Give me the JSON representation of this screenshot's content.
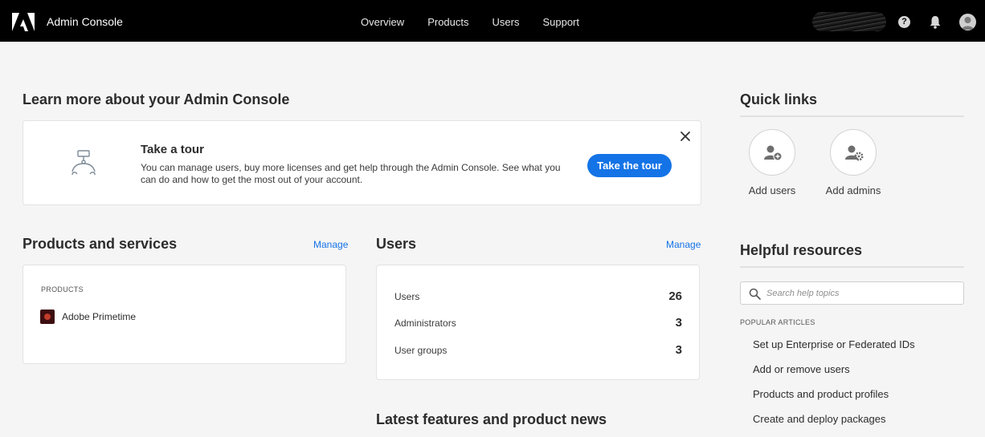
{
  "header": {
    "app_title": "Admin Console",
    "nav": [
      "Overview",
      "Products",
      "Users",
      "Support"
    ],
    "icons": [
      "adobe-logo-icon",
      "help-icon",
      "bell-icon",
      "avatar"
    ]
  },
  "learn": {
    "heading": "Learn more about your Admin Console",
    "tour_title": "Take a tour",
    "tour_text": "You can manage users, buy more licenses and get help through the Admin Console. See what you can do and how to get the most out of your account.",
    "tour_button": "Take the tour"
  },
  "products": {
    "heading": "Products and services",
    "manage": "Manage",
    "section_label": "PRODUCTS",
    "items": [
      {
        "name": "Adobe Primetime"
      }
    ]
  },
  "users": {
    "heading": "Users",
    "manage": "Manage",
    "stats": [
      {
        "label": "Users",
        "value": "26"
      },
      {
        "label": "Administrators",
        "value": "3"
      },
      {
        "label": "User groups",
        "value": "3"
      }
    ]
  },
  "news": {
    "heading": "Latest features and product news"
  },
  "quick_links": {
    "heading": "Quick links",
    "items": [
      {
        "label": "Add users",
        "icon": "add-user-icon"
      },
      {
        "label": "Add admins",
        "icon": "add-admin-icon"
      }
    ]
  },
  "resources": {
    "heading": "Helpful resources",
    "search_placeholder": "Search help topics",
    "popular_label": "POPULAR ARTICLES",
    "articles": [
      "Set up Enterprise or Federated IDs",
      "Add or remove users",
      "Products and product profiles",
      "Create and deploy packages"
    ]
  },
  "colors": {
    "accent": "#1473e6",
    "topbar": "#000000",
    "background": "#f5f5f5"
  }
}
